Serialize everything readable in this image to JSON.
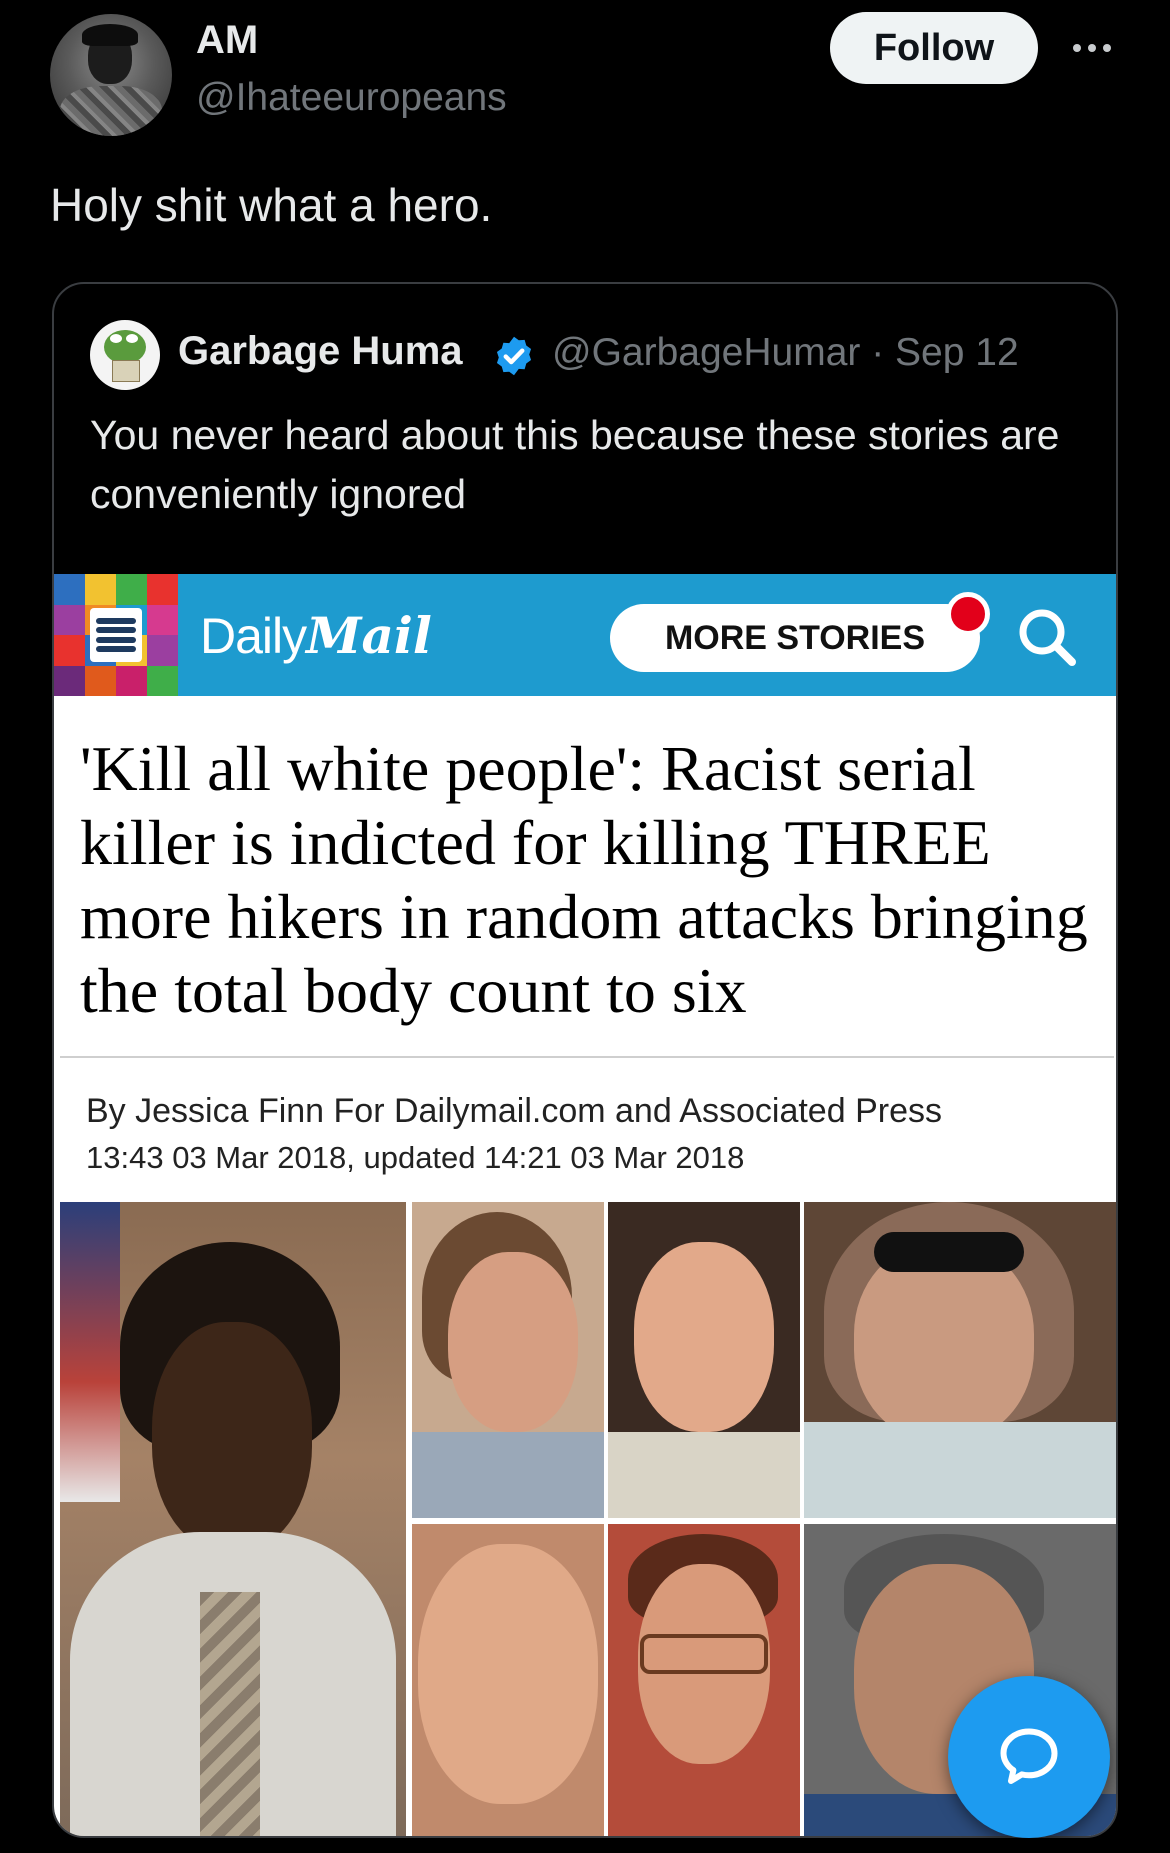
{
  "author": {
    "display_name": "AM",
    "handle": "@Ihateeuropeans",
    "follow_label": "Follow"
  },
  "tweet": {
    "text": "Holy shit what a hero."
  },
  "quoted": {
    "display_name": "Garbage Huma",
    "meta": "@GarbageHumar · Sep 12",
    "text": "You never heard about this because these stories are conveniently ignored"
  },
  "article": {
    "site_name_light": "Daily",
    "site_name_bold": "Mail",
    "more_stories_label": "MORE STORIES",
    "headline": "'Kill all white people': Racist serial killer is indicted for killing THREE more hikers in random attacks bringing the total body count to six",
    "byline": "By Jessica Finn For Dailymail.com and Associated Press",
    "timestamp": "13:43 03 Mar 2018, updated 14:21 03 Mar 2018"
  },
  "colors": {
    "background": "#000000",
    "accent": "#1d9bf0",
    "dailymail_blue": "#1e9bcf",
    "notification_red": "#e2001a"
  }
}
